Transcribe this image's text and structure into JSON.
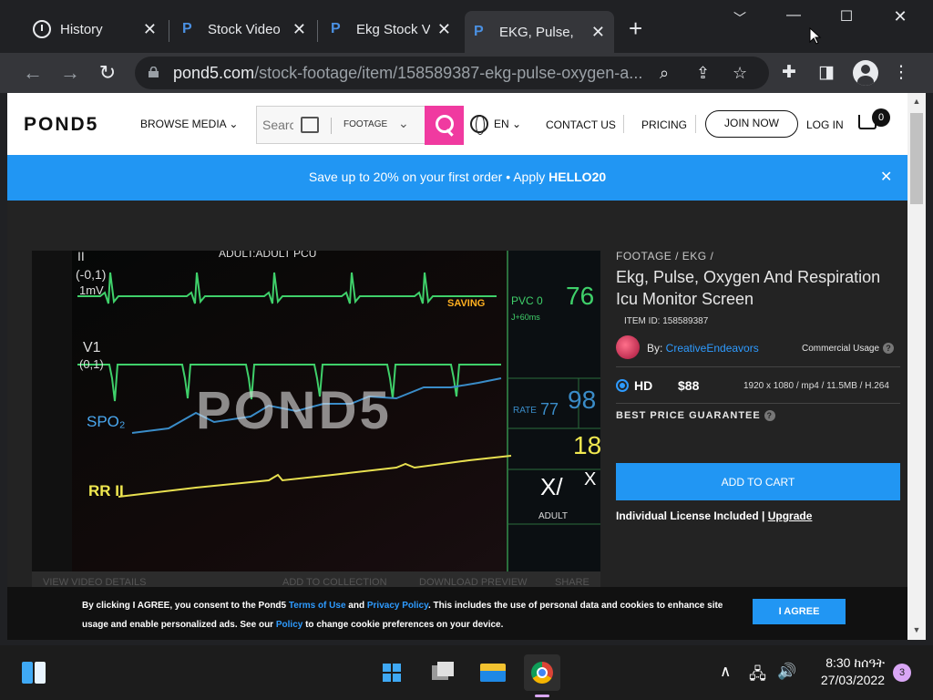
{
  "browser": {
    "tabs": [
      {
        "title": "History",
        "icon": "history-icon"
      },
      {
        "title": "Stock Video",
        "icon": "pond5-favicon"
      },
      {
        "title": "Ekg Stock V",
        "icon": "pond5-favicon"
      },
      {
        "title": "EKG, Pulse, ",
        "icon": "pond5-favicon",
        "active": true
      }
    ],
    "url_host": "pond5.com",
    "url_path": "/stock-footage/item/158589387-ekg-pulse-oxygen-a..."
  },
  "header": {
    "logo": "POND5",
    "browse": "BROWSE MEDIA",
    "search_placeholder": "Search",
    "media_type": "FOOTAGE",
    "lang": "EN",
    "contact": "CONTACT US",
    "pricing": "PRICING",
    "join": "JOIN NOW",
    "login": "LOG IN",
    "cart_count": "0"
  },
  "promo": {
    "text": "Save up to 20% on your first order • Apply ",
    "code": "HELLO20"
  },
  "video": {
    "watermark": "POND5",
    "monitor_labels": {
      "top": "ADULT:ADULT PCU",
      "lead2": "II",
      "scale1": "(-0,1)",
      "mv": "1mV",
      "v1": "V1",
      "scale2": "(0,1)",
      "spo2": "SPO₂",
      "rr": "RR II",
      "saving": "SAVING",
      "pvc": "PVC 0",
      "hr": "76",
      "st": "J+60ms",
      "rate": "RATE",
      "rate_small": "77",
      "spo2_val": "98",
      "resp": "18",
      "x1": "X/",
      "x2": "X",
      "adult": "ADULT"
    },
    "bar": {
      "details": "VIEW VIDEO DETAILS",
      "collection": "ADD TO COLLECTION",
      "preview": "DOWNLOAD PREVIEW",
      "share": "SHARE"
    }
  },
  "product": {
    "breadcrumb": "FOOTAGE / EKG /",
    "title": "Ekg, Pulse, Oxygen And Respiration Icu Monitor Screen",
    "item_id": "ITEM ID: 158589387",
    "by": "By: ",
    "author": "CreativeEndeavors",
    "usage": "Commercial Usage",
    "format": "HD",
    "price": "$88",
    "spec": "1920 x 1080 / mp4 / 11.5MB / H.264",
    "guarantee": "BEST PRICE GUARANTEE",
    "add_to_cart": "ADD TO CART",
    "license": "Individual License Included",
    "license_sep": " | ",
    "upgrade": "Upgrade"
  },
  "cookie": {
    "text1": "By clicking I AGREE, you consent to the Pond5 ",
    "terms": "Terms of Use",
    "and": " and ",
    "privacy": "Privacy Policy",
    "text2": ". This includes the use of personal data and cookies to enhance site usage and enable personalized ads. See our ",
    "policy": "Policy",
    "text3": " to change cookie preferences on your device.",
    "button": "I AGREE"
  },
  "taskbar": {
    "time": "8:30 ከሰዓት",
    "date": "27/03/2022",
    "notifications": "3"
  },
  "colors": {
    "accent_blue": "#2196f3",
    "search_pink": "#f03aa0",
    "link_blue": "#2e9bff"
  }
}
